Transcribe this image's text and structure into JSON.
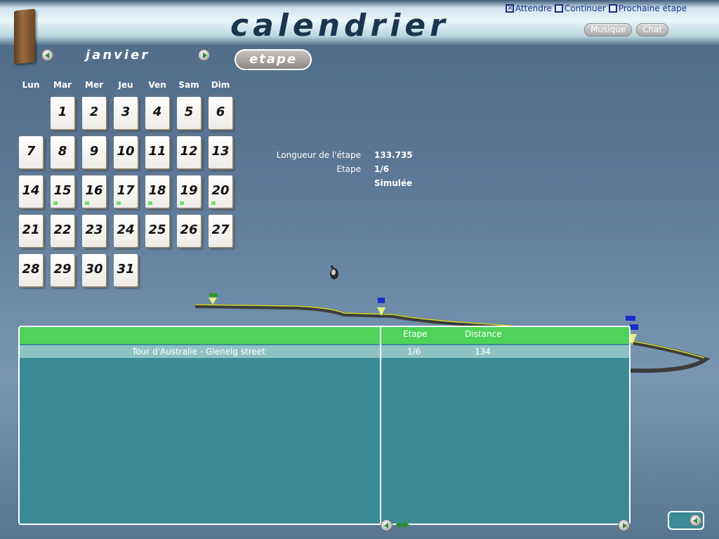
{
  "header": {
    "title": "calendrier",
    "options": [
      {
        "label": "Attendre",
        "checked": true
      },
      {
        "label": "Continuer",
        "checked": false
      },
      {
        "label": "Prochaine étape",
        "checked": false
      }
    ],
    "music_button": "Musique",
    "chat_button": "Chat"
  },
  "calendar": {
    "month": "janvier",
    "etape_button": "etape",
    "weekdays": [
      "Lun",
      "Mar",
      "Mer",
      "Jeu",
      "Ven",
      "Sam",
      "Dim"
    ],
    "days": [
      "1",
      "2",
      "3",
      "4",
      "5",
      "6",
      "7",
      "8",
      "9",
      "10",
      "11",
      "12",
      "13",
      "14",
      "15",
      "16",
      "17",
      "18",
      "19",
      "20",
      "21",
      "22",
      "23",
      "24",
      "25",
      "26",
      "27",
      "28",
      "29",
      "30",
      "31"
    ],
    "marked_days": [
      "15",
      "16",
      "17",
      "18",
      "19",
      "20"
    ]
  },
  "stage_info": {
    "length_label": "Longueur de l'étape",
    "length_value": "133.735",
    "stage_label": "Etape",
    "stage_value": "1/6",
    "status_value": "Simulée"
  },
  "table": {
    "headers": {
      "stage": "Etape",
      "distance": "Distance"
    },
    "rows": [
      {
        "name": "Tour d'Australie - Glenelg street",
        "stage": "1/6",
        "distance": "134"
      }
    ]
  },
  "colors": {
    "accent_green": "#4fd35a",
    "table_bg": "#3b8b96",
    "title_color": "#1a3550"
  },
  "icons": [
    "book-icon",
    "prev-month-icon",
    "next-month-icon",
    "mouse-cursor-icon",
    "scroll-left-icon",
    "scroll-right-icon",
    "back-icon"
  ]
}
